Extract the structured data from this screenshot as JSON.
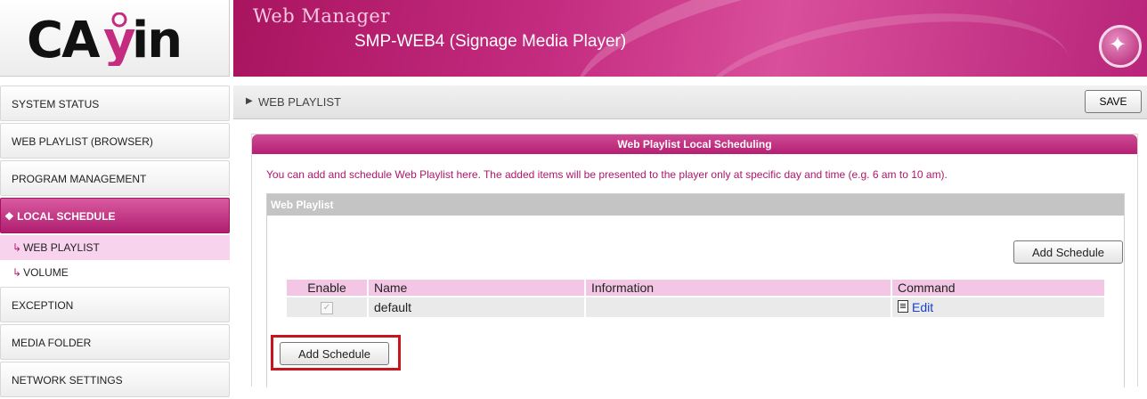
{
  "header": {
    "logo_text": "CAYIN",
    "app_title": "Web Manager",
    "product": "SMP-WEB4 (Signage Media Player)"
  },
  "sidebar": {
    "items": [
      {
        "label": "SYSTEM STATUS"
      },
      {
        "label": "WEB PLAYLIST (BROWSER)"
      },
      {
        "label": "PROGRAM MANAGEMENT"
      },
      {
        "label": "LOCAL SCHEDULE"
      },
      {
        "label": "EXCEPTION"
      },
      {
        "label": "MEDIA FOLDER"
      },
      {
        "label": "NETWORK SETTINGS"
      }
    ],
    "subitems": [
      {
        "label": "WEB PLAYLIST"
      },
      {
        "label": "VOLUME"
      }
    ]
  },
  "titlebar": {
    "title": "WEB PLAYLIST",
    "save_label": "SAVE"
  },
  "panel": {
    "header": "Web Playlist Local Scheduling",
    "description": "You can add and schedule Web Playlist here. The added items will be presented to the player only at specific day and time (e.g. 6 am to 10 am).",
    "section_title": "Web Playlist",
    "add_schedule_top": "Add Schedule",
    "add_schedule_bottom": "Add Schedule"
  },
  "table": {
    "columns": [
      "Enable",
      "Name",
      "Information",
      "Command"
    ],
    "rows": [
      {
        "enabled": true,
        "name": "default",
        "information": "",
        "command": "Edit"
      }
    ]
  },
  "colors": {
    "accent": "#b51f72",
    "selected_sub": "#f8d3ee",
    "highlight_border": "#c4161c"
  }
}
